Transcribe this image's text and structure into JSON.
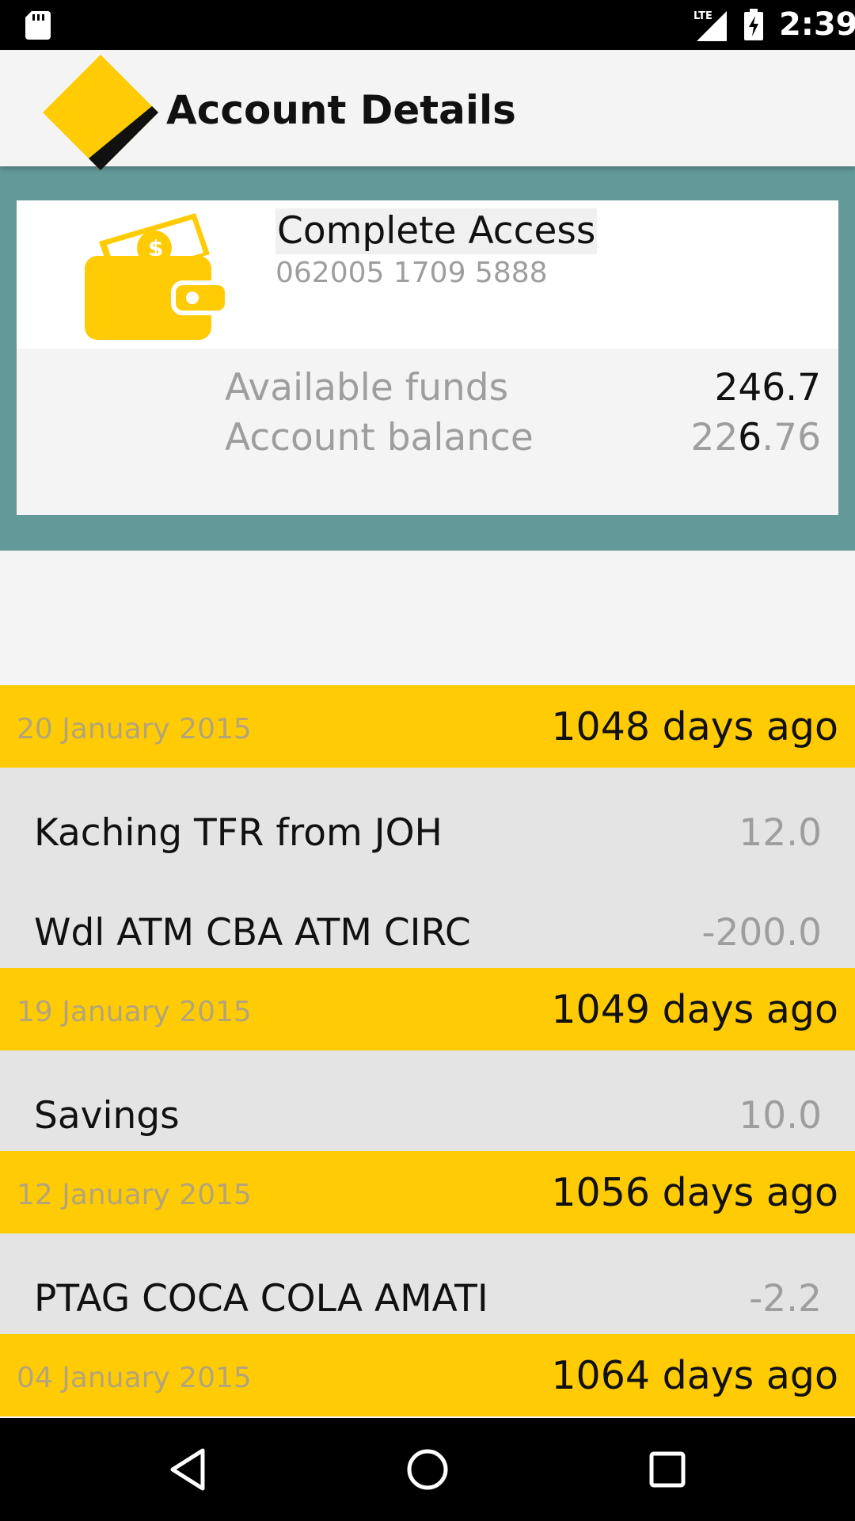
{
  "status_bar": {
    "time": "2:39",
    "network_label": "LTE",
    "icons": [
      "sd-card-icon",
      "lte-signal-icon",
      "battery-charging-icon"
    ]
  },
  "app_bar": {
    "title": "Account Details",
    "logo_icon": "commbank-diamond-logo"
  },
  "account": {
    "name": "Complete Access",
    "number": "062005 1709 5888",
    "icon": "wallet-icon",
    "available_funds_label": "Available funds",
    "available_funds_value": "246.7",
    "account_balance_label": "Account balance",
    "account_balance_value": "226.76",
    "overlap_digit": "6"
  },
  "transactions": [
    {
      "date": "20 January 2015",
      "days_ago": "1048 days ago",
      "items": [
        {
          "description": "Kaching TFR from JOH",
          "amount": "12.0"
        },
        {
          "description": "Wdl ATM CBA ATM CIRC",
          "amount": "-200.0"
        }
      ]
    },
    {
      "date": "19 January 2015",
      "days_ago": "1049 days ago",
      "items": [
        {
          "description": "Savings",
          "amount": "10.0"
        }
      ]
    },
    {
      "date": "12 January 2015",
      "days_ago": "1056 days ago",
      "items": [
        {
          "description": "PTAG COCA COLA AMATI",
          "amount": "-2.2"
        }
      ]
    },
    {
      "date": "04 January 2015",
      "days_ago": "1064 days ago",
      "items": []
    }
  ],
  "colors": {
    "brand_yellow": "#ffcb05",
    "account_band": "#639a99",
    "status_bar": "#000000"
  },
  "nav_bar": {
    "buttons": [
      "back-icon",
      "home-icon",
      "recents-icon"
    ]
  }
}
